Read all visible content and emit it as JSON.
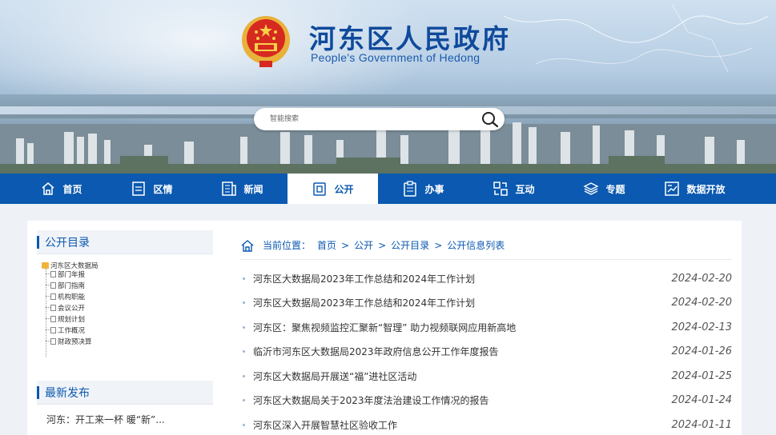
{
  "header": {
    "title": "河东区人民政府",
    "subtitle": "People's Government of Hedong",
    "search_placeholder": "智能搜索"
  },
  "nav": [
    {
      "label": "首页",
      "icon": "home-icon"
    },
    {
      "label": "区情",
      "icon": "document-icon"
    },
    {
      "label": "新闻",
      "icon": "news-icon"
    },
    {
      "label": "公开",
      "icon": "open-icon",
      "active": true
    },
    {
      "label": "办事",
      "icon": "clipboard-icon"
    },
    {
      "label": "互动",
      "icon": "interact-icon"
    },
    {
      "label": "专题",
      "icon": "layers-icon"
    },
    {
      "label": "数据开放",
      "icon": "data-chart-icon"
    }
  ],
  "sidebar": {
    "catalog_title": "公开目录",
    "tree_root": "河东区大数据局",
    "tree_items": [
      "部门年报",
      "部门指南",
      "机构职能",
      "会议公开",
      "规划计划",
      "工作概况",
      "财政预决算"
    ],
    "latest_title": "最新发布",
    "latest_items": [
      "河东：开工来一杯 暖“新”..."
    ]
  },
  "breadcrumb": {
    "label": "当前位置：",
    "items": [
      "首页",
      "公开",
      "公开目录",
      "公开信息列表"
    ],
    "separator": ">"
  },
  "articles": [
    {
      "title": "河东区大数据局2023年工作总结和2024年工作计划",
      "date": "2024-02-20"
    },
    {
      "title": "河东区大数据局2023年工作总结和2024年工作计划",
      "date": "2024-02-20"
    },
    {
      "title": "河东区：聚焦视频监控汇聚新“智理” 助力视频联网应用新高地",
      "date": "2024-02-13"
    },
    {
      "title": "临沂市河东区大数据局2023年政府信息公开工作年度报告",
      "date": "2024-01-26"
    },
    {
      "title": "河东区大数据局开展送“福”进社区活动",
      "date": "2024-01-25"
    },
    {
      "title": "河东区大数据局关于2023年度法治建设工作情况的报告",
      "date": "2024-01-24"
    },
    {
      "title": "河东区深入开展智慧社区验收工作",
      "date": "2024-01-11"
    }
  ],
  "colors": {
    "nav_bg": "#0b59b0",
    "title": "#0f4a9c",
    "accent": "#0b59b0"
  }
}
